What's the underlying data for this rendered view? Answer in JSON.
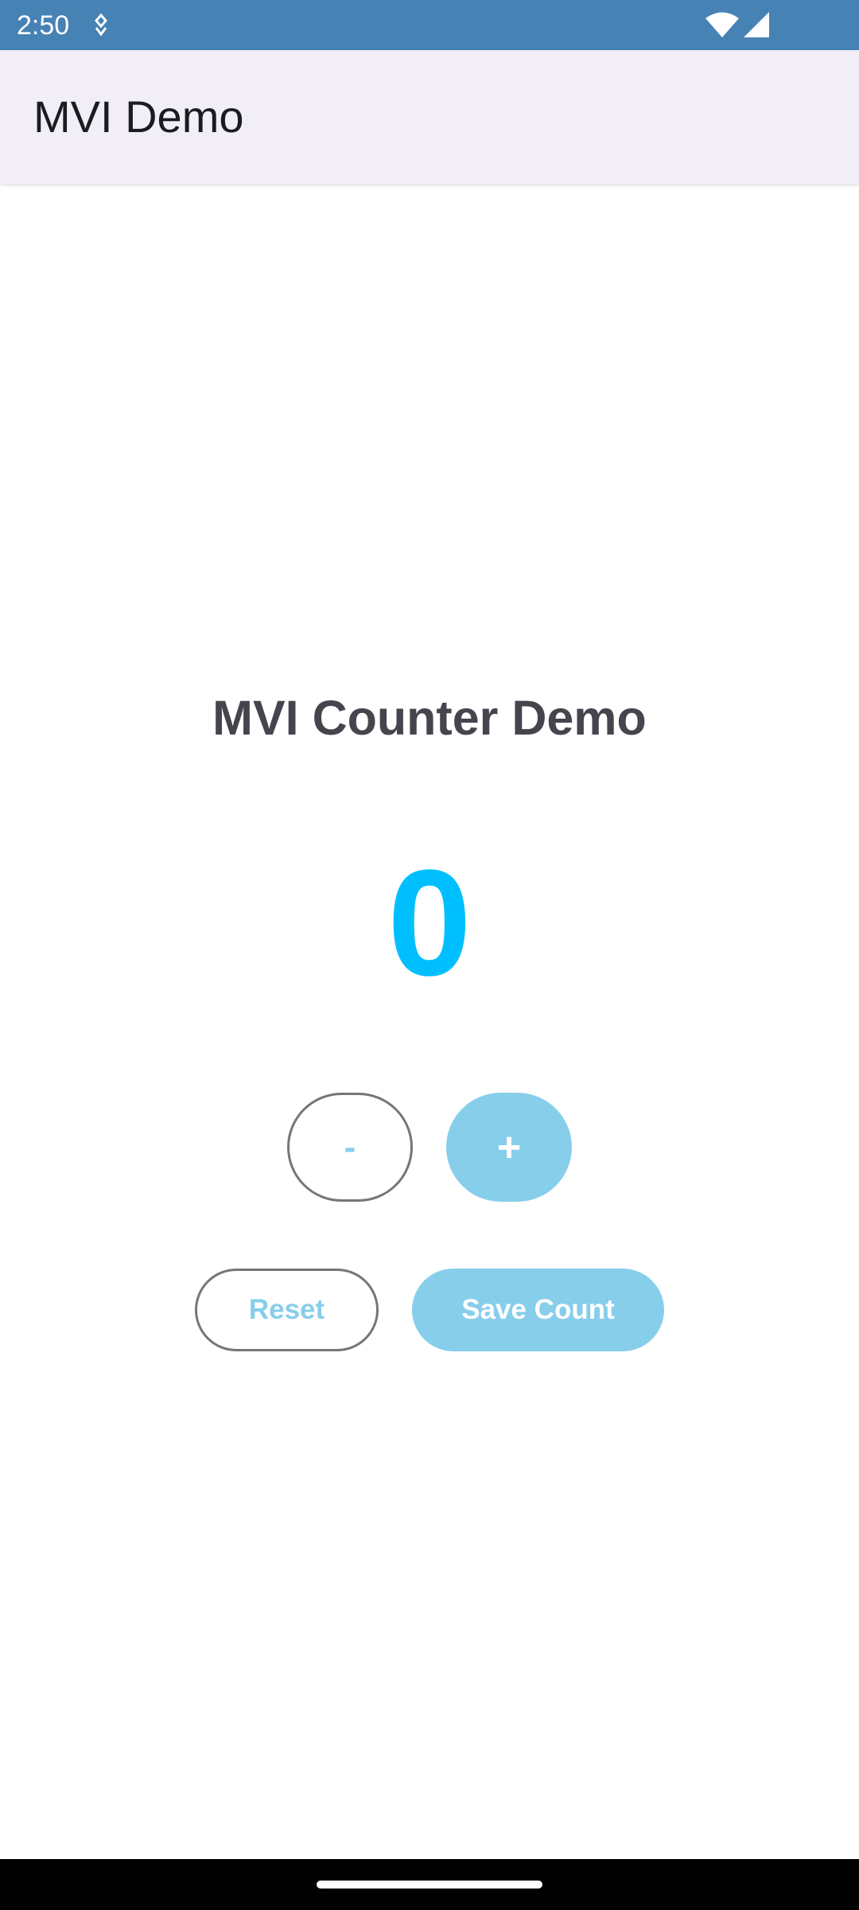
{
  "status_bar": {
    "time": "2:50",
    "notification_icon": "notification-icon",
    "wifi_icon": "wifi-icon",
    "signal_icon": "cell-signal-icon",
    "background_color": "#4682b4"
  },
  "app_bar": {
    "title": "MVI Demo",
    "background_color": "#f2eef7"
  },
  "main": {
    "heading": "MVI Counter Demo",
    "counter_value": "0",
    "counter_color": "#00bfff",
    "buttons": {
      "decrement_label": "-",
      "increment_label": "+",
      "reset_label": "Reset",
      "save_label": "Save Count"
    },
    "accent_color": "#87ceeb"
  },
  "nav_bar": {
    "home_handle_icon": "home-handle"
  }
}
